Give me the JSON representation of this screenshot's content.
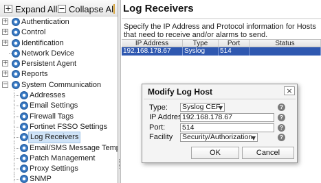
{
  "toolbar": {
    "expand_label": "Expand All",
    "collapse_label": "Collapse All"
  },
  "tree": {
    "items": [
      {
        "label": "Authentication",
        "level": 1,
        "expander": "+"
      },
      {
        "label": "Control",
        "level": 1,
        "expander": "+"
      },
      {
        "label": "Identification",
        "level": 1,
        "expander": "+"
      },
      {
        "label": "Network Device",
        "level": 1,
        "expander": ""
      },
      {
        "label": "Persistent Agent",
        "level": 1,
        "expander": "+"
      },
      {
        "label": "Reports",
        "level": 1,
        "expander": "+"
      },
      {
        "label": "System Communication",
        "level": 1,
        "expander": "−"
      },
      {
        "label": "Addresses",
        "level": 2
      },
      {
        "label": "Email Settings",
        "level": 2
      },
      {
        "label": "Firewall Tags",
        "level": 2
      },
      {
        "label": "Fortinet FSSO Settings",
        "level": 2
      },
      {
        "label": "Log Receivers",
        "level": 2,
        "selected": true
      },
      {
        "label": "Email/SMS Message Templates",
        "level": 2
      },
      {
        "label": "Patch Management",
        "level": 2
      },
      {
        "label": "Proxy Settings",
        "level": 2
      },
      {
        "label": "SNMP",
        "level": 2
      }
    ]
  },
  "main": {
    "title": "Log Receivers",
    "description": "Specify the IP Address and Protocol information for Hosts that need to receive and/or alarms to send.",
    "table": {
      "columns": [
        "IP Address",
        "Type",
        "Port",
        "Status"
      ],
      "rows": [
        {
          "ip": "192.168.178.67",
          "type": "Syslog CEF",
          "port": "514",
          "status": ""
        }
      ]
    }
  },
  "dialog": {
    "title": "Modify Log Host",
    "close": "×",
    "type_label": "Type:",
    "type_value": "Syslog CEF",
    "ip_label": "IP Address:",
    "ip_value": "192.168.178.67",
    "port_label": "Port:",
    "port_value": "514",
    "facility_label": "Facility",
    "facility_value": "Security/Authorization",
    "help_glyph": "?",
    "ok_label": "OK",
    "cancel_label": "Cancel"
  }
}
